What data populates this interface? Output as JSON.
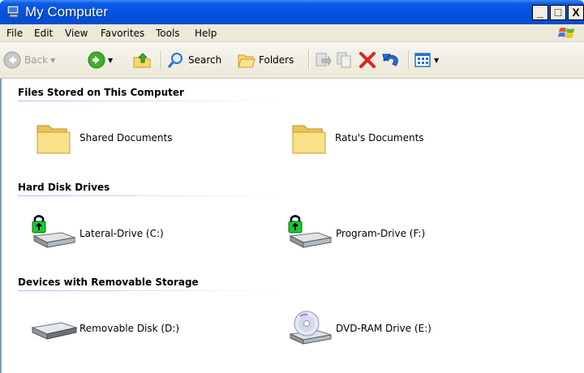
{
  "window": {
    "title": "My Computer"
  },
  "menu": {
    "file": "File",
    "edit": "Edit",
    "view": "View",
    "favorites": "Favorites",
    "tools": "Tools",
    "help": "Help"
  },
  "toolbar": {
    "back_label": "Back",
    "search_label": "Search",
    "folders_label": "Folders"
  },
  "groups": {
    "files": {
      "header": "Files Stored on This Computer",
      "items": [
        "Shared Documents",
        "Ratu's Documents"
      ]
    },
    "hard_disks": {
      "header": "Hard Disk Drives",
      "items": [
        "Lateral-Drive (C:)",
        "Program-Drive (F:)"
      ]
    },
    "removable": {
      "header": "Devices with Removable Storage",
      "items": [
        "Removable Disk (D:)",
        "DVD-RAM Drive (E:)"
      ]
    }
  },
  "colors": {
    "titlebar": "#0553e0",
    "chrome": "#ece9d8",
    "delete_red": "#e2231a",
    "folder_yellow": "#f7d96c"
  }
}
